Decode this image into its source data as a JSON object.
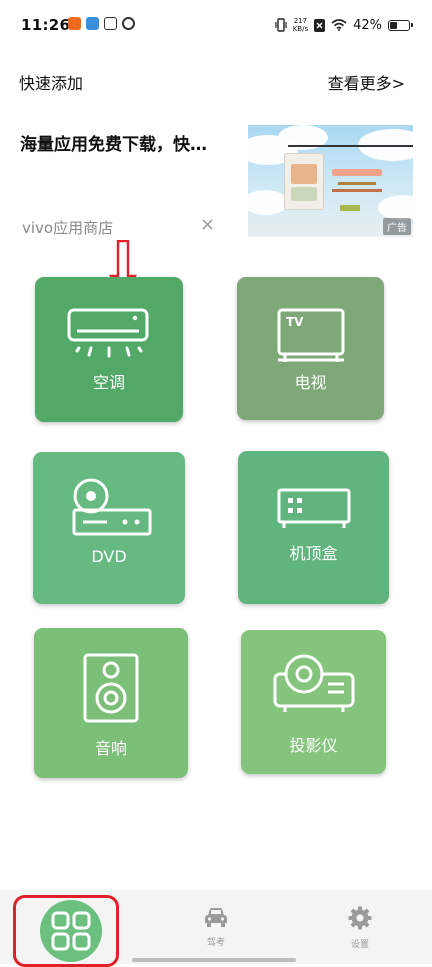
{
  "status_bar": {
    "time": "11:26",
    "net_speed_value": "217",
    "net_speed_unit": "KB/s",
    "battery_percent": "42%",
    "battery_level": 0.42
  },
  "header": {
    "quick_add": "快速添加",
    "see_more": "查看更多>"
  },
  "ad": {
    "title": "海量应用免费下载，快…",
    "source": "vivo应用商店",
    "close": "×",
    "badge": "广告"
  },
  "devices": [
    {
      "label": "空调",
      "icon": "air-conditioner-icon",
      "color": "#52a866"
    },
    {
      "label": "电视",
      "icon": "tv-icon",
      "color": "#7ea877"
    },
    {
      "label": "DVD",
      "icon": "dvd-player-icon",
      "color": "#65b981"
    },
    {
      "label": "机顶盒",
      "icon": "set-top-box-icon",
      "color": "#60b47e"
    },
    {
      "label": "音响",
      "icon": "speaker-icon",
      "color": "#7cbf78"
    },
    {
      "label": "投影仪",
      "icon": "projector-icon",
      "color": "#84c47c"
    }
  ],
  "nav": {
    "home_icon": "grid-icon",
    "drive_label": "驾考",
    "drive_icon": "car-icon",
    "settings_label": "设置",
    "settings_icon": "gear-icon"
  },
  "colors": {
    "highlight": "#e0202a",
    "fab": "#6cc07f"
  }
}
